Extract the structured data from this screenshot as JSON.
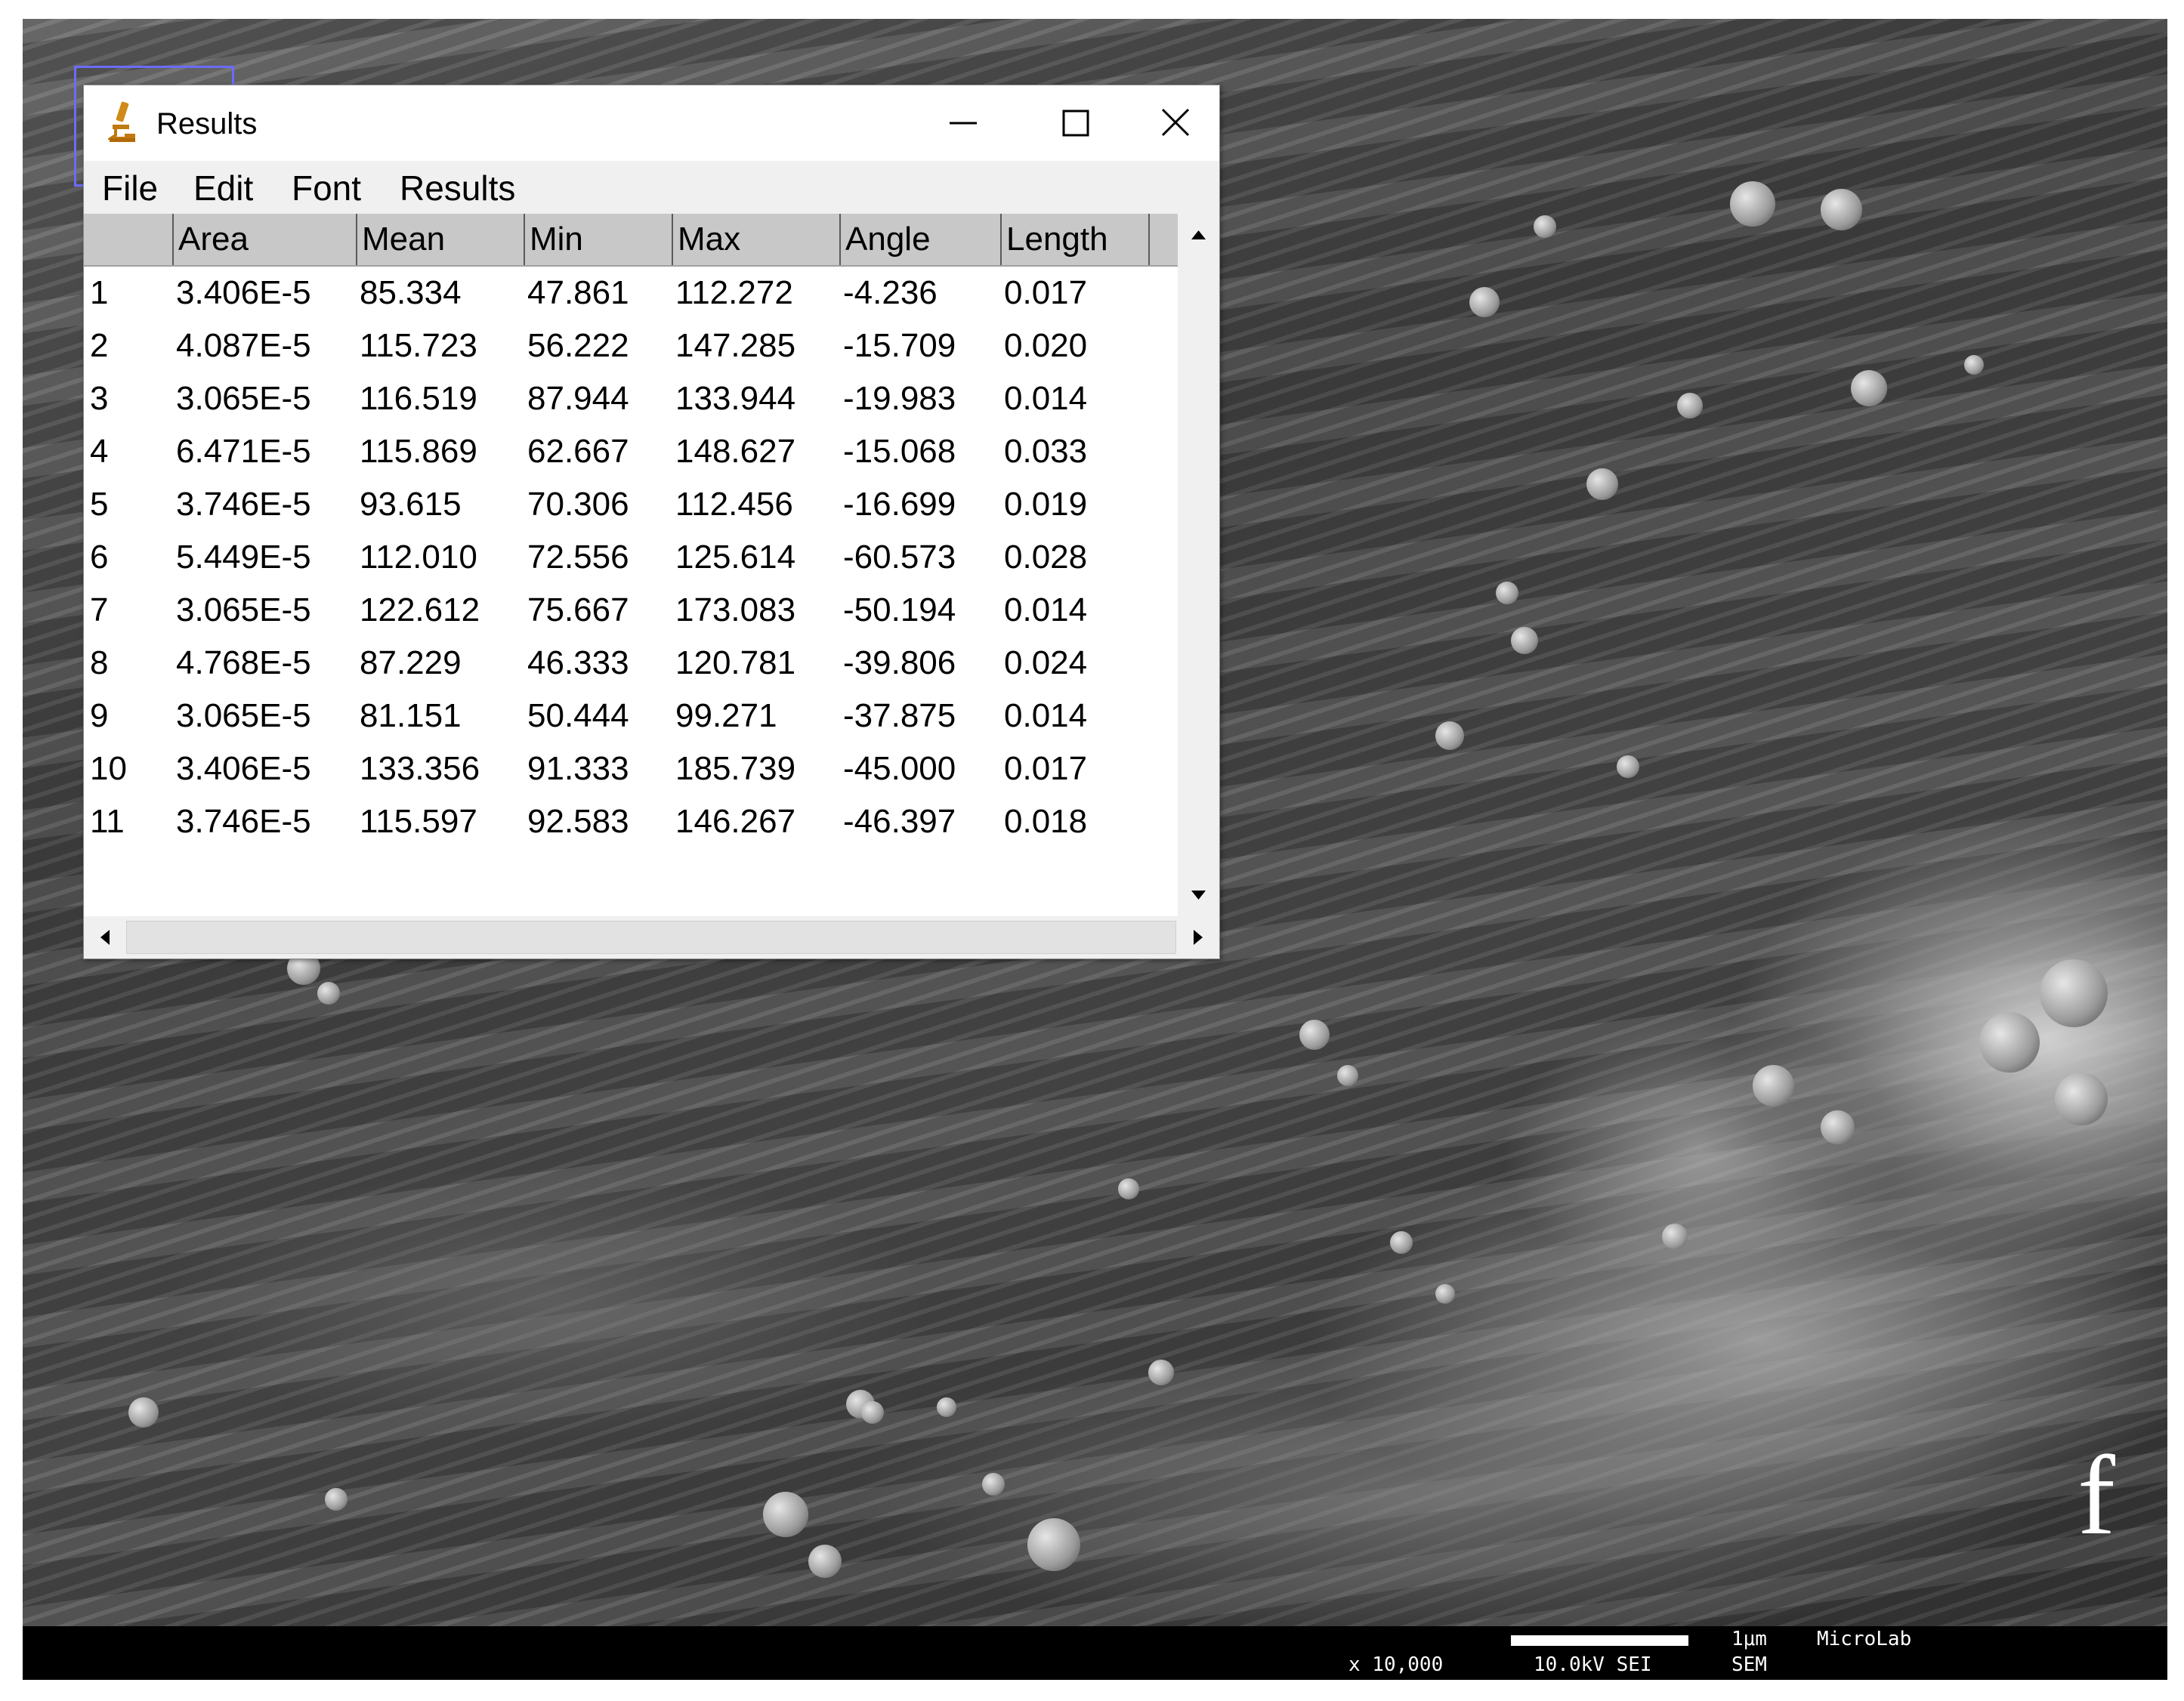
{
  "window": {
    "title": "Results",
    "menu": [
      "File",
      "Edit",
      "Font",
      "Results"
    ]
  },
  "table": {
    "columns": [
      "",
      "Area",
      "Mean",
      "Min",
      "Max",
      "Angle",
      "Length"
    ],
    "rows": [
      [
        "1",
        "3.406E-5",
        "85.334",
        "47.861",
        "112.272",
        "-4.236",
        "0.017"
      ],
      [
        "2",
        "4.087E-5",
        "115.723",
        "56.222",
        "147.285",
        "-15.709",
        "0.020"
      ],
      [
        "3",
        "3.065E-5",
        "116.519",
        "87.944",
        "133.944",
        "-19.983",
        "0.014"
      ],
      [
        "4",
        "6.471E-5",
        "115.869",
        "62.667",
        "148.627",
        "-15.068",
        "0.033"
      ],
      [
        "5",
        "3.746E-5",
        "93.615",
        "70.306",
        "112.456",
        "-16.699",
        "0.019"
      ],
      [
        "6",
        "5.449E-5",
        "112.010",
        "72.556",
        "125.614",
        "-60.573",
        "0.028"
      ],
      [
        "7",
        "3.065E-5",
        "122.612",
        "75.667",
        "173.083",
        "-50.194",
        "0.014"
      ],
      [
        "8",
        "4.768E-5",
        "87.229",
        "46.333",
        "120.781",
        "-39.806",
        "0.024"
      ],
      [
        "9",
        "3.065E-5",
        "81.151",
        "50.444",
        "99.271",
        "-37.875",
        "0.014"
      ],
      [
        "10",
        "3.406E-5",
        "133.356",
        "91.333",
        "185.739",
        "-45.000",
        "0.017"
      ],
      [
        "11",
        "3.746E-5",
        "115.597",
        "92.583",
        "146.267",
        "-46.397",
        "0.018"
      ]
    ]
  },
  "figure": {
    "panel_label": "f"
  },
  "sem_bar": {
    "magnification": "x 10,000",
    "voltage_mode": "10.0kV SEI",
    "scale": "1μm",
    "lab": "MicroLab",
    "detector": "SEM"
  },
  "icons": {
    "app": "microscope-icon",
    "minimize": "minimize-icon",
    "maximize": "maximize-icon",
    "close": "close-icon"
  },
  "colors": {
    "header_bg": "#c8c8c8",
    "selection_rect": "#6b6bff"
  }
}
